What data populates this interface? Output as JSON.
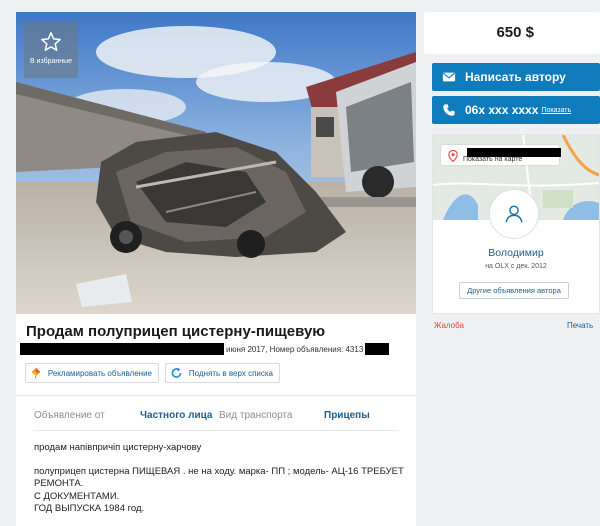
{
  "favorites": {
    "label": "В избранные"
  },
  "listing": {
    "title": "Продам полуприцеп цистерну-пищевую",
    "meta_text": "июня 2017, Номер объявления: 4313",
    "promo_advertise": "Рекламировать объявление",
    "promo_raise": "Поднять в верх списка"
  },
  "params": {
    "row1": [
      {
        "label": "Объявление от",
        "value": "Частного лица"
      },
      {
        "label": "Вид транспорта",
        "value": "Прицепы"
      }
    ]
  },
  "description": {
    "line1": "продам напівпричіп цистерну-харчову",
    "line2": "полуприцеп цистерна ПИЩЕВАЯ . не на ходу. марка- ПП ; модель- АЦ-16 ТРЕБУЕТ",
    "line3": "РЕМОНТА.",
    "line4": "С ДОКУМЕНТАМИ.",
    "line5": "ГОД ВЫПУСКА 1984 год."
  },
  "sidebar": {
    "price": "650 $",
    "write_author": "Написать автору",
    "phone": "06x xxx xxxx",
    "phone_show": "Показать",
    "show_on_map": "Показать на карте",
    "seller_name": "Володимир",
    "seller_since": "на OLX с дек. 2012",
    "other_ads": "Другие объявления автора",
    "complaint": "Жалоба",
    "print": "Печать"
  },
  "colors": {
    "accent": "#0e7bbd",
    "link": "#1f5d8c",
    "complaint": "#e0463b",
    "background": "#eef0f2"
  },
  "icons": [
    "star-icon",
    "envelope-icon",
    "phone-icon",
    "map-pin-icon",
    "user-icon",
    "kite-icon",
    "refresh-icon"
  ]
}
